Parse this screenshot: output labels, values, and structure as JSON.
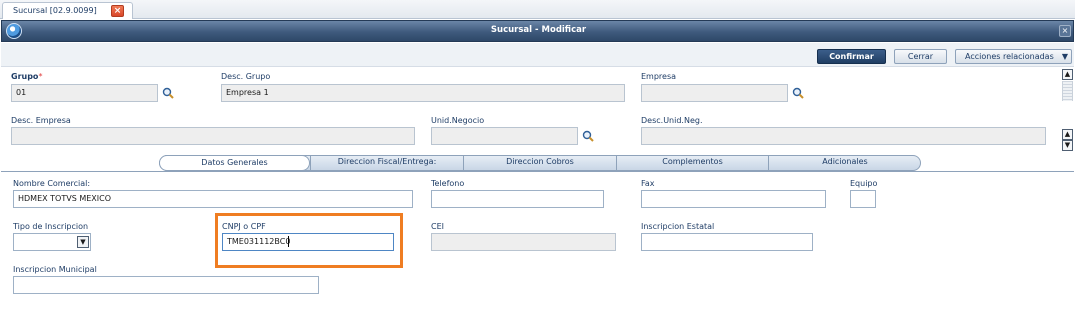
{
  "outer_tab": {
    "label": "Sucursal [02.9.0099]",
    "close_glyph": "×"
  },
  "window": {
    "title": "Sucursal - Modificar",
    "close_glyph": "×"
  },
  "toolbar": {
    "confirm_label": "Confirmar",
    "close_label": "Cerrar",
    "actions_label": "Acciones relacionadas",
    "actions_caret": "▼"
  },
  "header_fields": {
    "grupo": {
      "label": "Grupo",
      "required_mark": "*",
      "value": "01"
    },
    "desc_grupo": {
      "label": "Desc. Grupo",
      "value": "Empresa 1"
    },
    "empresa": {
      "label": "Empresa",
      "value": ""
    },
    "desc_empresa": {
      "label": "Desc. Empresa",
      "value": ""
    },
    "unid_negocio": {
      "label": "Unid.Negocio",
      "value": ""
    },
    "desc_unid_neg": {
      "label": "Desc.Unid.Neg.",
      "value": ""
    }
  },
  "scrollbar": {
    "up": "▲",
    "down": "▼"
  },
  "tabs": [
    {
      "label": "Datos Generales",
      "active": true
    },
    {
      "label": "Direccion Fiscal/Entrega:",
      "active": false
    },
    {
      "label": "Direccion Cobros",
      "active": false
    },
    {
      "label": "Complementos",
      "active": false
    },
    {
      "label": "Adicionales",
      "active": false
    }
  ],
  "general_fields": {
    "nombre_comercial": {
      "label": "Nombre Comercial:",
      "value": "HDMEX TOTVS MEXICO"
    },
    "telefono": {
      "label": "Telefono",
      "value": ""
    },
    "fax": {
      "label": "Fax",
      "value": ""
    },
    "equipo": {
      "label": "Equipo",
      "value": ""
    },
    "tipo_inscripcion": {
      "label": "Tipo de Inscripcion",
      "value": "",
      "caret": "▼"
    },
    "cnpj_cpf": {
      "label": "CNPJ o CPF",
      "value": "TME031112BC0"
    },
    "cei": {
      "label": "CEI",
      "value": ""
    },
    "inscripcion_estatal": {
      "label": "Inscripcion Estatal",
      "value": ""
    },
    "inscripcion_municipal": {
      "label": "Inscripcion Municipal",
      "value": ""
    }
  },
  "colors": {
    "title_bar": "#3f5a7d",
    "confirm_button": "#203e63",
    "highlight": "#ef7d22",
    "required": "#e03b3b"
  },
  "icons": {
    "lookup": "magnifier-icon",
    "app": "app-logo-icon",
    "tab_close": "close-icon"
  }
}
